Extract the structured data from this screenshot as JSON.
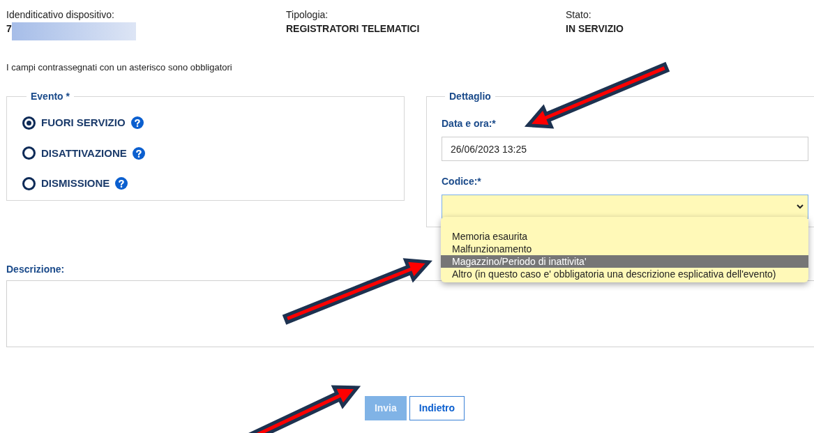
{
  "header": [
    {
      "label": "Idenditicativo dispositivo:",
      "value": "7",
      "redacted": true
    },
    {
      "label": "Tipologia:",
      "value": "REGISTRATORI TELEMATICI",
      "redacted": false
    },
    {
      "label": "Stato:",
      "value": "IN SERVIZIO",
      "redacted": false
    }
  ],
  "note": "I campi contrassegnati con un asterisco sono obbligatori",
  "evento": {
    "legend": "Evento *",
    "options": [
      {
        "label": "FUORI SERVIZIO",
        "selected": true
      },
      {
        "label": "DISATTIVAZIONE",
        "selected": false
      },
      {
        "label": "DISMISSIONE",
        "selected": false
      }
    ]
  },
  "dettaglio": {
    "legend": "Dettaglio",
    "date_label": "Data e ora:*",
    "date_value": "26/06/2023 13:25",
    "code_label": "Codice:*",
    "code_options": [
      {
        "label": "Memoria esaurita",
        "selected": false
      },
      {
        "label": "Malfunzionamento",
        "selected": false
      },
      {
        "label": "Magazzino/Periodo di inattivita'",
        "selected": true
      },
      {
        "label": "Altro (in questo caso e' obbligatoria una descrizione esplicativa dell'evento)",
        "selected": false
      }
    ]
  },
  "descrizione": {
    "label": "Descrizione:"
  },
  "buttons": [
    {
      "label": "Invia",
      "kind": "primary",
      "disabled": true
    },
    {
      "label": "Indietro",
      "kind": "secondary",
      "disabled": false
    }
  ]
}
